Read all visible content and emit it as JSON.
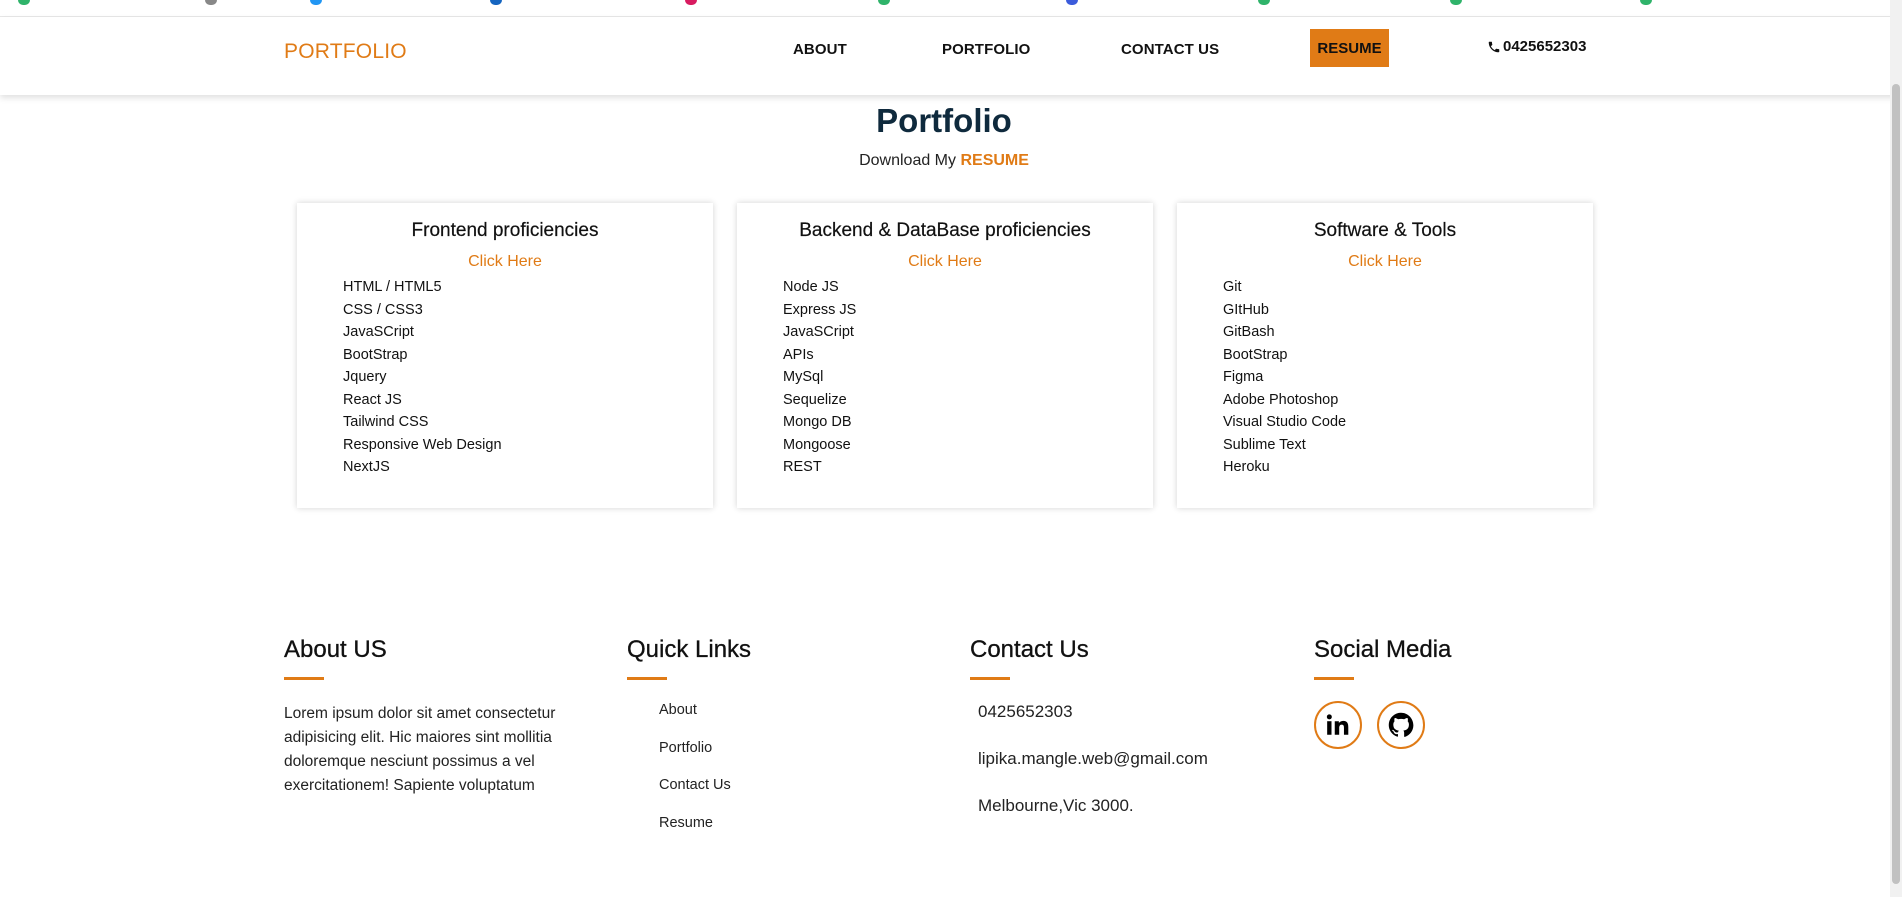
{
  "navbar": {
    "brand": "PORTFOLIO",
    "links": [
      "ABOUT",
      "PORTFOLIO",
      "CONTACT US"
    ],
    "resume_label": "RESUME",
    "phone": "0425652303"
  },
  "header": {
    "title": "Portfolio",
    "download_prefix": "Download My",
    "download_link": "RESUME"
  },
  "cards": [
    {
      "title": "Frontend proficiencies",
      "link": "Click Here",
      "items": [
        "HTML / HTML5",
        "CSS / CSS3",
        "JavaSCript",
        "BootStrap",
        "Jquery",
        "React JS",
        "Tailwind CSS",
        "Responsive Web Design",
        "NextJS"
      ]
    },
    {
      "title": "Backend & DataBase proficiencies",
      "link": "Click Here",
      "items": [
        "Node JS",
        "Express JS",
        "JavaSCript",
        "APIs",
        "MySql",
        "Sequelize",
        "Mongo DB",
        "Mongoose",
        "REST"
      ]
    },
    {
      "title": "Software & Tools",
      "link": "Click Here",
      "items": [
        "Git",
        "GItHub",
        "GitBash",
        "BootStrap",
        "Figma",
        "Adobe Photoshop",
        "Visual Studio Code",
        "Sublime Text",
        "Heroku"
      ]
    }
  ],
  "footer": {
    "about": {
      "heading": "About US",
      "text": "Lorem ipsum dolor sit amet consectetur adipisicing elit. Hic maiores sint mollitia doloremque nesciunt possimus a vel exercitationem! Sapiente voluptatum"
    },
    "quick_links": {
      "heading": "Quick Links",
      "items": [
        "About",
        "Portfolio",
        "Contact Us",
        "Resume"
      ]
    },
    "contact": {
      "heading": "Contact Us",
      "phone": "0425652303",
      "email": "lipika.mangle.web@gmail.com",
      "address": "Melbourne,Vic 3000."
    },
    "social": {
      "heading": "Social Media",
      "icons": [
        "linkedin-icon",
        "github-icon"
      ]
    }
  },
  "colors": {
    "accent": "#e07b16",
    "title": "#0f2a3d"
  }
}
